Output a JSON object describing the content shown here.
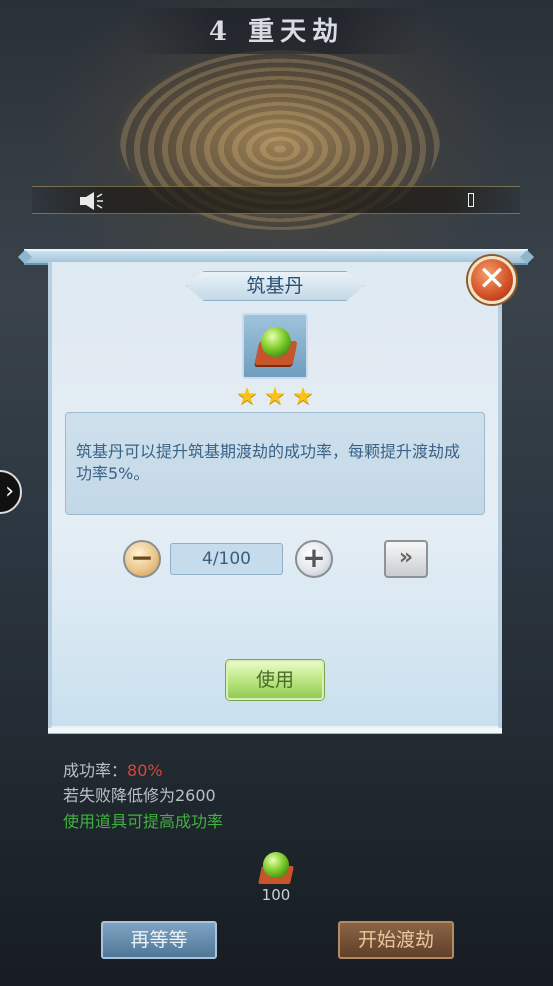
{
  "header": {
    "title": "4 重天劫"
  },
  "notice": {
    "speaker_icon": "speaker-icon",
    "end_icon": "bracket-icon"
  },
  "side": {
    "arrow": "›"
  },
  "dialog": {
    "item_name": "筑基丹",
    "close_glyph": "✕",
    "stars": [
      "★",
      "★",
      "★"
    ],
    "star_color": "#f7c21b",
    "description": "筑基丹可以提升筑基期渡劫的成功率，每颗提升渡劫成功率5%。",
    "quantity": "4/100",
    "minus_glyph": "−",
    "plus_glyph": "+",
    "max_glyph": "»",
    "use_label": "使用"
  },
  "info": {
    "success_label": "成功率：",
    "success_value": "80%",
    "fail_text": "若失败降低修为2600",
    "tip_text": "使用道具可提高成功率"
  },
  "bottom": {
    "item_count": "100",
    "wait_label": "再等等",
    "start_label": "开始渡劫"
  },
  "colors": {
    "success_pct": "#d9453a",
    "tip": "#3fb23f",
    "panel": "#e6eef5"
  }
}
